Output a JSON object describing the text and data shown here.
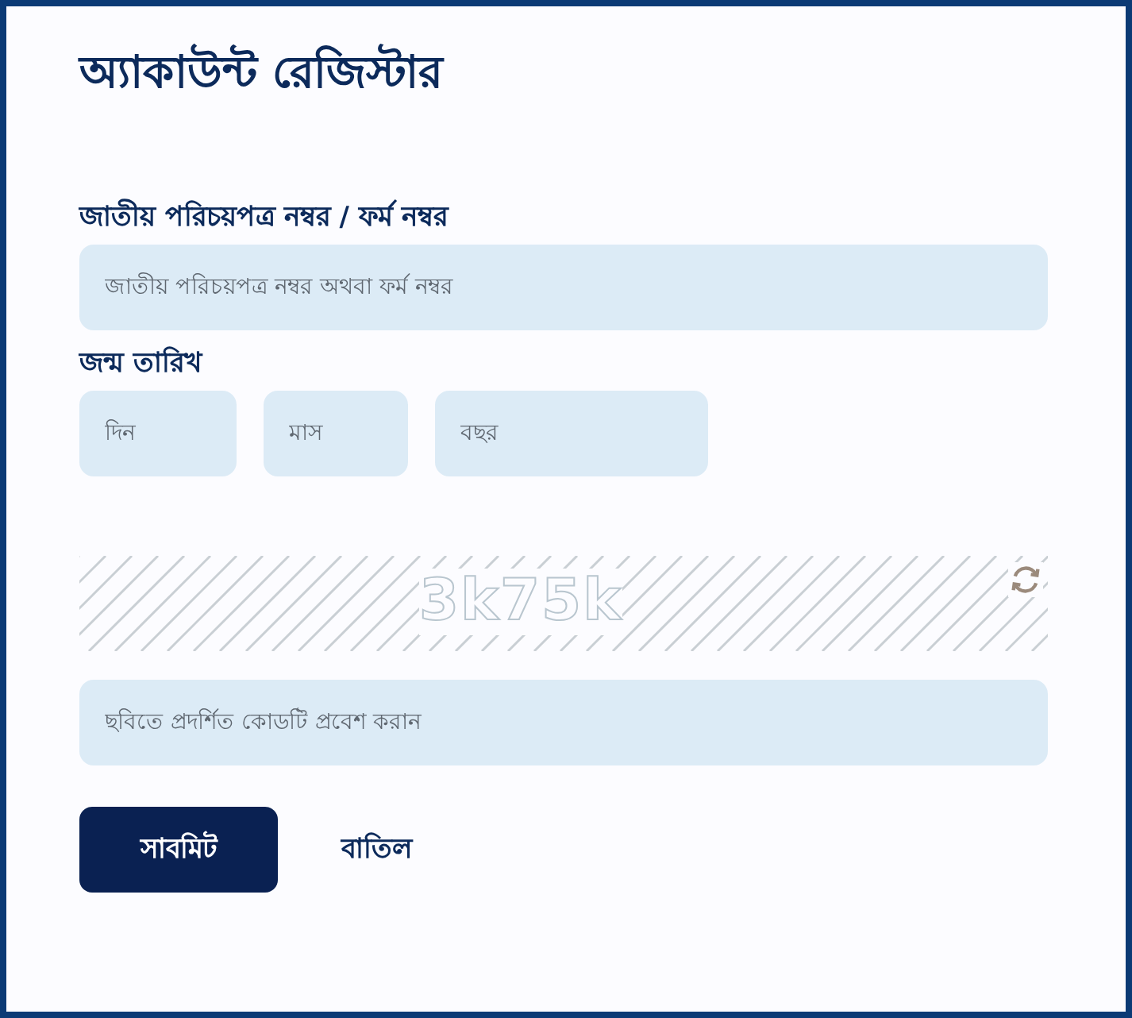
{
  "title": "অ্যাকাউন্ট রেজিস্টার",
  "id_field": {
    "label": "জাতীয় পরিচয়পত্র নম্বর / ফর্ম নম্বর",
    "placeholder": "জাতীয় পরিচয়পত্র নম্বর অথবা ফর্ম নম্বর"
  },
  "birth_date": {
    "label": "জন্ম তারিখ",
    "fields": [
      {
        "placeholder": "দিন"
      },
      {
        "placeholder": "মাস"
      },
      {
        "placeholder": "বছর"
      }
    ]
  },
  "captcha": {
    "text": "3k75k"
  },
  "code_field": {
    "placeholder": "ছবিতে প্রদর্শিত কোডটি প্রবেশ করান"
  },
  "buttons": [
    {
      "label": "সাবমিট",
      "kind": "primary"
    },
    {
      "label": "বাতিল",
      "kind": "plain"
    }
  ]
}
